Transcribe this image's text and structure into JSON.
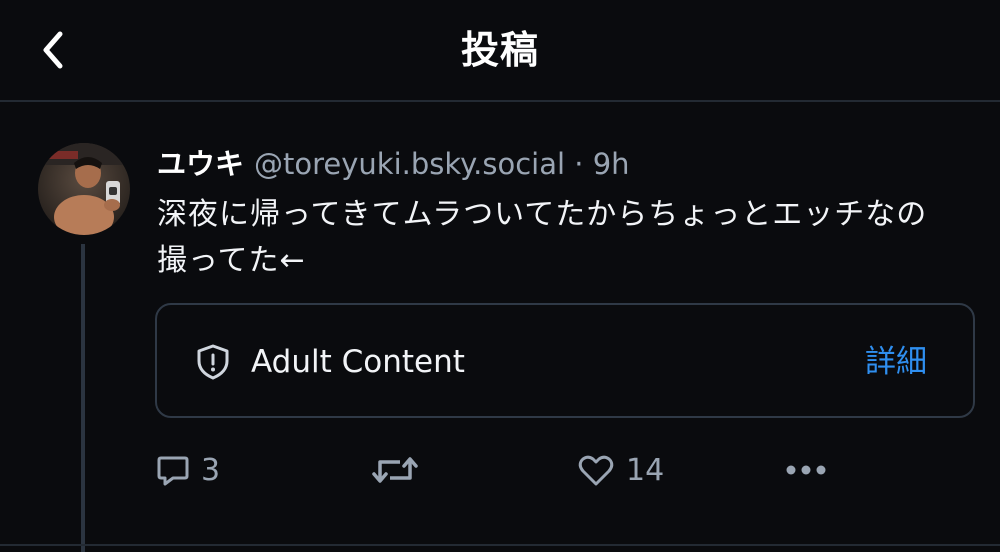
{
  "header": {
    "title": "投稿",
    "back_icon": "chevron-left-icon"
  },
  "post": {
    "author": {
      "display_name": "ユウキ",
      "handle": "@toreyuki.bsky.social",
      "avatar_icon": "user-avatar"
    },
    "separator": "·",
    "time": "9h",
    "text": "深夜に帰ってきてムラついてたからちょっとエッチなの撮ってた←",
    "content_warning": {
      "icon": "shield-alert-icon",
      "label": "Adult Content",
      "details_label": "詳細"
    },
    "actions": {
      "reply": {
        "icon": "reply-bubble-icon",
        "count": "3"
      },
      "repost": {
        "icon": "repost-icon"
      },
      "like": {
        "icon": "heart-icon",
        "count": "14"
      },
      "more": {
        "icon": "more-dots-icon"
      }
    }
  },
  "colors": {
    "background": "#0a0b0e",
    "text": "#ffffff",
    "muted": "#9aa5b3",
    "accent": "#2f8ff0",
    "border": "#2f3946"
  }
}
